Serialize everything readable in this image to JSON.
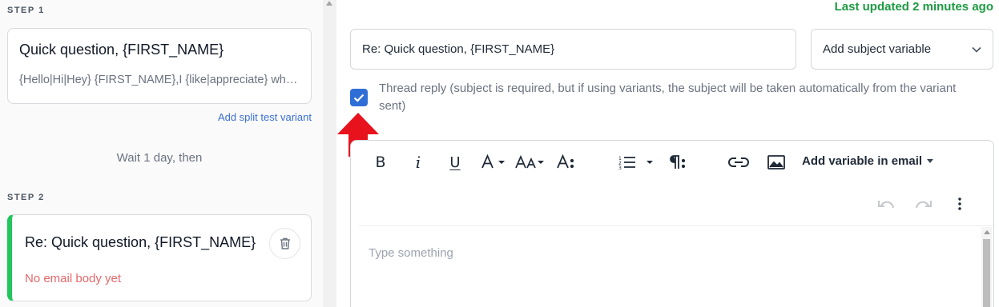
{
  "sequence": {
    "step1": {
      "label": "STEP 1",
      "subject": "Quick question, {FIRST_NAME}",
      "body_preview": "{Hello|Hi|Hey} {FIRST_NAME},I {like|appreciate} what you are doing",
      "add_variant_label": "Add split test variant"
    },
    "wait_text": "Wait 1 day, then",
    "step2": {
      "label": "STEP 2",
      "subject": "Re: Quick question, {FIRST_NAME}",
      "empty_body": "No email body yet",
      "delete_icon": "trash-icon"
    }
  },
  "editor_panel": {
    "last_updated": "Last updated 2 minutes ago",
    "subject_value": "Re: Quick question, {FIRST_NAME}",
    "variable_select": {
      "selected": "Add subject variable",
      "icon": "chevron-down-icon"
    },
    "thread_reply": {
      "checked": true,
      "label": "Thread reply (subject is required, but if using variants, the subject will be taken automatically from the variant sent)"
    },
    "toolbar": {
      "bold": "B",
      "italic": "i",
      "underline": "U",
      "add_variable_label": "Add variable in email"
    },
    "body_placeholder": "Type something"
  },
  "colors": {
    "accent_blue": "#2f6ed6",
    "link_blue": "#3b6fd4",
    "success_green": "#1e9a43",
    "active_bar_green": "#22c55e",
    "error_red": "#e4686b",
    "annotation_arrow": "#e8121c"
  }
}
